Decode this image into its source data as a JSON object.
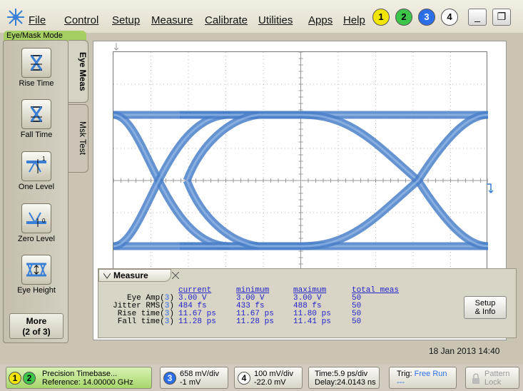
{
  "menu": {
    "items": [
      "File",
      "Control",
      "Setup",
      "Measure",
      "Calibrate",
      "Utilities",
      "Apps",
      "Help"
    ],
    "channels": [
      "1",
      "2",
      "3",
      "4"
    ],
    "channel_colors": [
      "#f2e600",
      "#3cc64a",
      "#2c6ee8",
      "#ffffff"
    ]
  },
  "mode_tab": "Eye/Mask Mode",
  "tabs": {
    "eye_meas": "Eye Meas",
    "msk_test": "Msk Test"
  },
  "tools": [
    {
      "label": "Rise Time",
      "icon": "rise-time-icon"
    },
    {
      "label": "Fall Time",
      "icon": "fall-time-icon"
    },
    {
      "label": "One Level",
      "icon": "one-level-icon"
    },
    {
      "label": "Zero Level",
      "icon": "zero-level-icon"
    },
    {
      "label": "Eye Height",
      "icon": "eye-height-icon"
    }
  ],
  "more_button": {
    "line1": "More",
    "line2": "(2 of 3)"
  },
  "measure": {
    "title": "Measure",
    "headers": {
      "current": "current",
      "minimum": "minimum",
      "maximum": "maximum",
      "total": "total meas"
    },
    "rows": [
      {
        "label": "Eye Amp(",
        "ch": "3",
        "current": "3.00 V",
        "minimum": "3.00 V",
        "maximum": "3.00 V",
        "total": "50"
      },
      {
        "label": "Jitter RMS(",
        "ch": "3",
        "current": "484 fs",
        "minimum": "433 fs",
        "maximum": "488 fs",
        "total": "50"
      },
      {
        "label": "Rise time(",
        "ch": "3",
        "current": "11.67 ps",
        "minimum": "11.67 ps",
        "maximum": "11.80 ps",
        "total": "50"
      },
      {
        "label": "Fall time(",
        "ch": "3",
        "current": "11.28 ps",
        "minimum": "11.28 ps",
        "maximum": "11.41 ps",
        "total": "50"
      }
    ],
    "setup_line1": "Setup",
    "setup_line2": "& Info"
  },
  "datetime": "18 Jan 2013  14:40",
  "bottom": {
    "timebase_line1": "Precision Timebase...",
    "timebase_line2": "Reference: 14.00000 GHz",
    "ch3_scale": "658 mV/div",
    "ch3_offset": "-1 mV",
    "ch4_scale": "100 mV/div",
    "ch4_offset": "-22.0 mV",
    "time_line1": "Time:5.9 ps/div",
    "time_line2": "Delay:24.0143 ns",
    "trig_label": "Trig:",
    "trig_value": "Free Run",
    "pattern_line1": "Pattern",
    "pattern_line2": "Lock"
  },
  "trace_color": "#4a7fc8"
}
